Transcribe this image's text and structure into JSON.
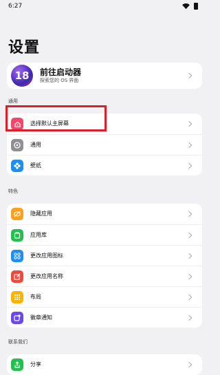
{
  "status": {
    "time": "6:27"
  },
  "page": {
    "title": "设置"
  },
  "profile": {
    "avatar_text": "18",
    "title": "前往启动器",
    "subtitle": "探索您的 OS 界面"
  },
  "sections": {
    "general": {
      "label": "通用",
      "items": [
        {
          "label": "选择默认主屏幕",
          "icon": "home-icon",
          "color": "#f4466a"
        },
        {
          "label": "通用",
          "icon": "gear-icon",
          "color": "#8e8e93"
        },
        {
          "label": "壁纸",
          "icon": "flower-icon",
          "color": "#1e8ff0"
        }
      ]
    },
    "features": {
      "label": "特色",
      "items": [
        {
          "label": "隐藏应用",
          "icon": "eye-hidden-icon",
          "color": "#ff9f1a"
        },
        {
          "label": "应用库",
          "icon": "app-library-icon",
          "color": "#22c14f"
        },
        {
          "label": "更改应用图标",
          "icon": "grid-icon",
          "color": "#1e8ff0"
        },
        {
          "label": "更改应用名称",
          "icon": "edit-icon",
          "color": "#f2473a"
        },
        {
          "label": "布局",
          "icon": "layout-icon",
          "color": "#ffb300"
        },
        {
          "label": "徽章通知",
          "icon": "badge-icon",
          "color": "#6b49e6"
        }
      ]
    },
    "contact": {
      "label": "联系我们",
      "items": [
        {
          "label": "分享",
          "icon": "share-icon",
          "color": "#22c14f"
        }
      ]
    }
  }
}
